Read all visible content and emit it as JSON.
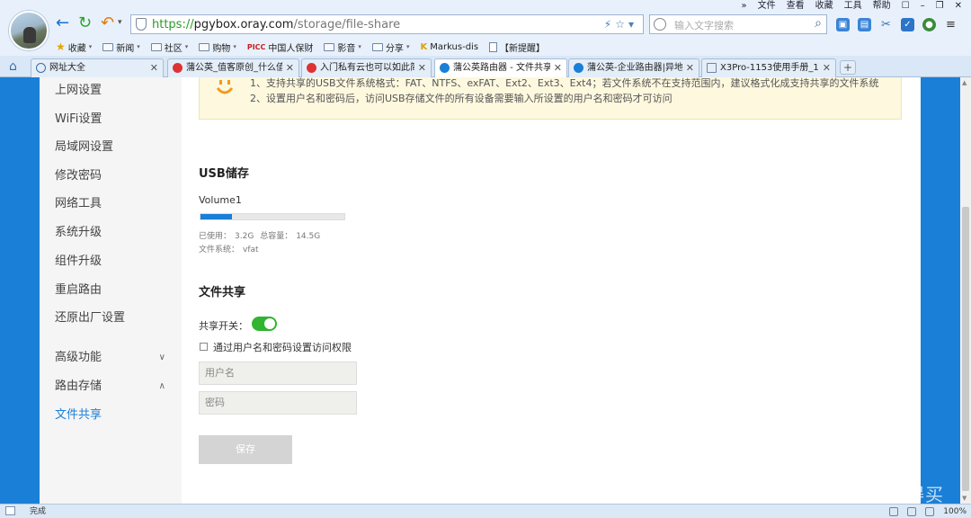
{
  "browser": {
    "url": {
      "protocol": "https://",
      "host": "pgybox.oray.com",
      "path": "/storage/file-share"
    },
    "search_placeholder": "输入文字搜索",
    "menu": [
      "»",
      "文件",
      "查看",
      "收藏",
      "工具",
      "帮助"
    ],
    "bookmarks": [
      {
        "label": "收藏",
        "icon": "star-icon",
        "has_caret": true
      },
      {
        "label": "新闻",
        "icon": "folder-icon",
        "has_caret": true
      },
      {
        "label": "社区",
        "icon": "folder-icon",
        "has_caret": true
      },
      {
        "label": "购物",
        "icon": "folder-icon",
        "has_caret": true
      },
      {
        "label": "中国人保财",
        "icon": "picc-icon",
        "has_caret": false
      },
      {
        "label": "影音",
        "icon": "folder-icon",
        "has_caret": true
      },
      {
        "label": "分享",
        "icon": "folder-icon",
        "has_caret": true
      },
      {
        "label": "Markus-dis",
        "icon": "k-icon",
        "has_caret": false
      },
      {
        "label": "【新提醒】",
        "icon": "doc-icon",
        "has_caret": false
      }
    ],
    "tabs": [
      {
        "label": "网址大全",
        "favicon_color": "#3b6ea5",
        "active": false
      },
      {
        "label": "蒲公英_值客原创_什么值",
        "favicon_color": "#d33",
        "active": false
      },
      {
        "label": "入门私有云也可以如此简",
        "favicon_color": "#d33",
        "active": false
      },
      {
        "label": "蒲公英路由器 - 文件共享",
        "favicon_color": "#1a7fd6",
        "active": true
      },
      {
        "label": "蒲公英-企业路由器|异地组",
        "favicon_color": "#1a7fd6",
        "active": false
      },
      {
        "label": "X3Pro-1153使用手册_1",
        "favicon_color": "#6f86a3",
        "active": false
      }
    ],
    "status_text": "完成",
    "zoom": "100%"
  },
  "sidebar": {
    "items": [
      {
        "label": "上网设置"
      },
      {
        "label": "WiFi设置"
      },
      {
        "label": "局域网设置"
      },
      {
        "label": "修改密码"
      },
      {
        "label": "网络工具"
      },
      {
        "label": "系统升级"
      },
      {
        "label": "组件升级"
      },
      {
        "label": "重启路由"
      },
      {
        "label": "还原出厂设置"
      },
      {
        "label": "高级功能",
        "chevron": "down"
      },
      {
        "label": "路由存储",
        "chevron": "up"
      },
      {
        "label": "文件共享",
        "active": true
      }
    ]
  },
  "notice": {
    "line1": "1、支持共享的USB文件系统格式：FAT、NTFS、exFAT、Ext2、Ext3、Ext4；若文件系统不在支持范围内，建议格式化成支持共享的文件系统",
    "line2": "2、设置用户名和密码后，访问USB存储文件的所有设备需要输入所设置的用户名和密码才可访问"
  },
  "usb": {
    "title": "USB储存",
    "volume_name": "Volume1",
    "used_label": "已使用：",
    "used_value": "3.2G",
    "total_label": "总容量：",
    "total_value": "14.5G",
    "fs_label": "文件系统：",
    "fs_value": "vfat",
    "used_fraction": 0.22
  },
  "share": {
    "title": "文件共享",
    "switch_label": "共享开关：",
    "switch_on": true,
    "auth_checkbox_label": "通过用户名和密码设置访问权限",
    "auth_checked": false,
    "username_placeholder": "用户名",
    "password_placeholder": "密码",
    "save_label": "保存"
  },
  "watermark": "什么值得买",
  "colors": {
    "accent": "#1a7fd6",
    "toggle_on": "#2fb52f",
    "notice_bg": "#fdf8de"
  }
}
